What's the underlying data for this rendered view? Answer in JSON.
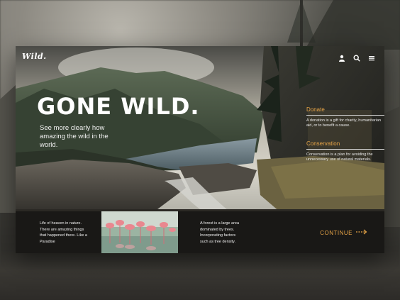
{
  "brand": {
    "logo": "Wild."
  },
  "nav": {
    "icons": [
      "user-icon",
      "search-icon",
      "menu-icon"
    ]
  },
  "hero": {
    "title": "GONE WILD.",
    "subtitle": "See more clearly how amazing the wild in the world."
  },
  "panels": [
    {
      "title": "Donate",
      "text": "A donation is a gift for charity, humanitarian aid, or to benefit a cause."
    },
    {
      "title": "Conservation",
      "text": "Conservation is a plan for avoiding the unnecessary use of natural materials."
    }
  ],
  "bottom": {
    "left_text": "Life of heaven in nature. There are amazing things that happened there. Like a Paradise",
    "right_text": "A forest is a large area dominated by trees. Incorporating factors such as tree density.",
    "continue_label": "CONTINUE"
  },
  "colors": {
    "accent": "#e8a547",
    "text": "#ffffff"
  }
}
